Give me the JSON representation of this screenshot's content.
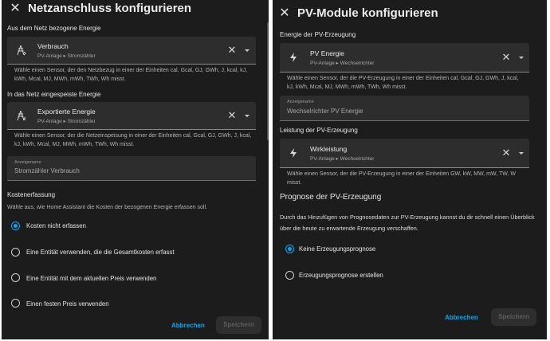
{
  "left": {
    "title": "Netzanschluss konfigurieren",
    "grid_from": {
      "section": "Aus dem Netz bezogene Energie",
      "picker": {
        "name": "Verbrauch",
        "device": "PV-Anlage",
        "entity": "Stromzähler",
        "separator": "▸",
        "icon": "transmission-tower-import-icon"
      },
      "help": "Wähle einen Sensor, der den Netzbezug in einer der Einheiten cal, Gcal, GJ, GWh, J, kcal, kJ, kWh, Mcal, MJ, MWh, mWh, TWh, Wh misst."
    },
    "grid_to": {
      "section": "In das Netz eingespeiste Energie",
      "picker": {
        "name": "Exportierte Energie",
        "device": "PV-Anlage",
        "entity": "Stromzähler",
        "separator": "▸",
        "icon": "transmission-tower-export-icon"
      },
      "help": "Wähle einen Sensor, der die Netzeinspeisung in einer der Einheiten cal, Gcal, GJ, GWh, J, kcal, kJ, kWh, Mcal, MJ, MWh, mWh, TWh, Wh misst."
    },
    "display_name": {
      "label": "Anzeigename",
      "value": "Stromzähler Verbrauch"
    },
    "cost": {
      "title": "Kostenerfassung",
      "desc": "Wähle aus, wie Home Assistant die Kosten der bezogenen Energie erfassen soll.",
      "options": [
        {
          "label": "Kosten nicht erfassen",
          "selected": true
        },
        {
          "label": "Eine Entität verwenden, die die Gesamtkosten erfasst",
          "selected": false
        },
        {
          "label": "Eine Entität mit dem aktuellen Preis verwenden",
          "selected": false
        },
        {
          "label": "Einen festen Preis verwenden",
          "selected": false
        }
      ]
    },
    "actions": {
      "cancel": "Abbrechen",
      "save": "Speichern"
    }
  },
  "right": {
    "title": "PV-Module konfigurieren",
    "energy": {
      "section": "Energie der PV-Erzeugung",
      "picker": {
        "name": "PV Energie",
        "device": "PV-Anlage",
        "entity": "Wechselrichter",
        "separator": "▸",
        "icon": "lightning-bolt-icon"
      },
      "help": "Wähle einen Sensor, der die PV-Erzeugung in einer der Einheiten cal, Gcal, GJ, GWh, J, kcal, kJ, kWh, Mcal, MJ, MWh, mWh, TWh, Wh misst."
    },
    "display_name": {
      "label": "Anzeigename",
      "value": "Wechselrichter PV Energie"
    },
    "power": {
      "section": "Leistung der PV-Erzeugung",
      "picker": {
        "name": "Wirkleistung",
        "device": "PV-Anlage",
        "entity": "Wechselrichter",
        "separator": "▸",
        "icon": "lightning-bolt-icon"
      },
      "help": "Wähle einen Sensor, der die PV-Erzeugung in einer der Einheiten GW, kW, MW, mW, TW, W misst."
    },
    "forecast": {
      "title": "Prognose der PV-Erzeugung",
      "desc": "Durch das Hinzufügen von Prognosedaten zur PV-Erzeugung kannst du dir schnell einen Überblick über die heute zu erwartende Erzeugung verschaffen.",
      "options": [
        {
          "label": "Keine Erzeugungsprognose",
          "selected": true
        },
        {
          "label": "Erzeugungsprognose erstellen",
          "selected": false
        }
      ]
    },
    "actions": {
      "cancel": "Abbrechen",
      "save": "Speichern"
    }
  },
  "colors": {
    "accent": "#03a9f4",
    "surface": "#1c1c1c",
    "field": "#2d2d2d"
  }
}
